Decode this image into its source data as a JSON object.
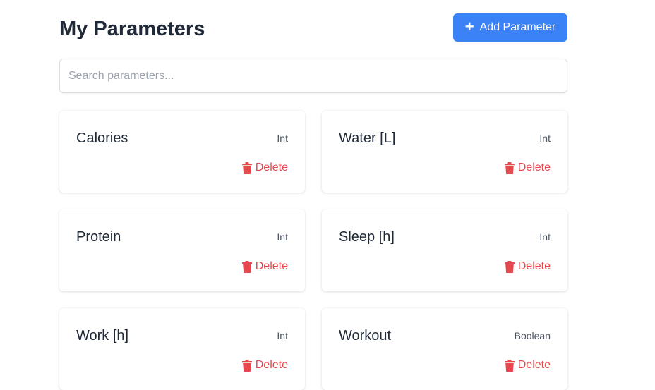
{
  "header": {
    "title": "My Parameters",
    "add_button_label": "Add Parameter",
    "add_button_icon": "plus-icon"
  },
  "search": {
    "placeholder": "Search parameters...",
    "value": ""
  },
  "parameters": [
    {
      "name": "Calories",
      "type": "Int",
      "delete_label": "Delete"
    },
    {
      "name": "Water [L]",
      "type": "Int",
      "delete_label": "Delete"
    },
    {
      "name": "Protein",
      "type": "Int",
      "delete_label": "Delete"
    },
    {
      "name": "Sleep [h]",
      "type": "Int",
      "delete_label": "Delete"
    },
    {
      "name": "Work [h]",
      "type": "Int",
      "delete_label": "Delete"
    },
    {
      "name": "Workout",
      "type": "Boolean",
      "delete_label": "Delete"
    }
  ],
  "colors": {
    "accent": "#3b82f6",
    "danger": "#e5484d",
    "text": "#1f2937"
  }
}
